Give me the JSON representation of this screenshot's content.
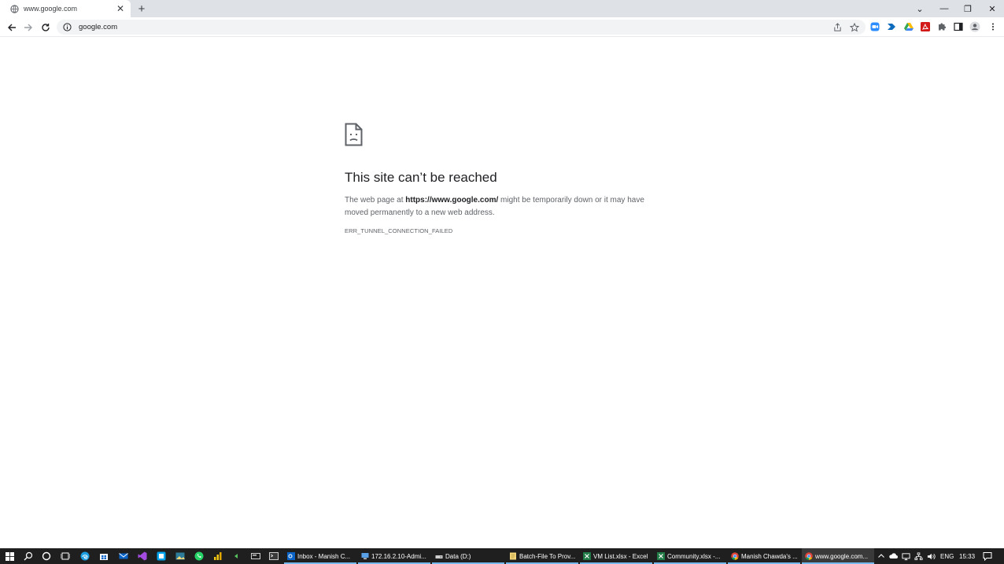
{
  "browser": {
    "tab": {
      "title": "www.google.com",
      "close": "✕"
    },
    "new_tab": "+",
    "window": {
      "dropdown": "⌄",
      "minimize": "—",
      "restore": "❐",
      "close": "✕"
    },
    "omnibox": {
      "url": "google.com"
    }
  },
  "error_page": {
    "title": "This site can’t be reached",
    "desc_prefix": "The web page at ",
    "desc_url": "https://www.google.com/",
    "desc_suffix": " might be temporarily down or it may have moved permanently to a new web address.",
    "code": "ERR_TUNNEL_CONNECTION_FAILED"
  },
  "taskbar": {
    "apps": [
      {
        "label": "Inbox - Manish C...",
        "icon": "outlook-icon",
        "color": "#0a64c8"
      },
      {
        "label": "172.16.2.10-Admi...",
        "icon": "remote-desktop-icon",
        "color": "#5aa0e6"
      },
      {
        "label": "Data (D:)",
        "icon": "drive-icon",
        "color": "#cfcfcf"
      },
      {
        "label": "Batch-File To Prov...",
        "icon": "notepad-icon",
        "color": "#f5d77a"
      },
      {
        "label": "VM List.xlsx - Excel",
        "icon": "excel-icon",
        "color": "#1f7a45"
      },
      {
        "label": "Community.xlsx -...",
        "icon": "excel-icon",
        "color": "#1f7a45"
      },
      {
        "label": "Manish Chawda's ...",
        "icon": "chrome-icon",
        "color": "#e8a33a"
      },
      {
        "label": "www.google.com...",
        "icon": "chrome-icon",
        "color": "#e8a33a"
      }
    ],
    "tray": {
      "language": "ENG",
      "time": "15:33"
    }
  }
}
